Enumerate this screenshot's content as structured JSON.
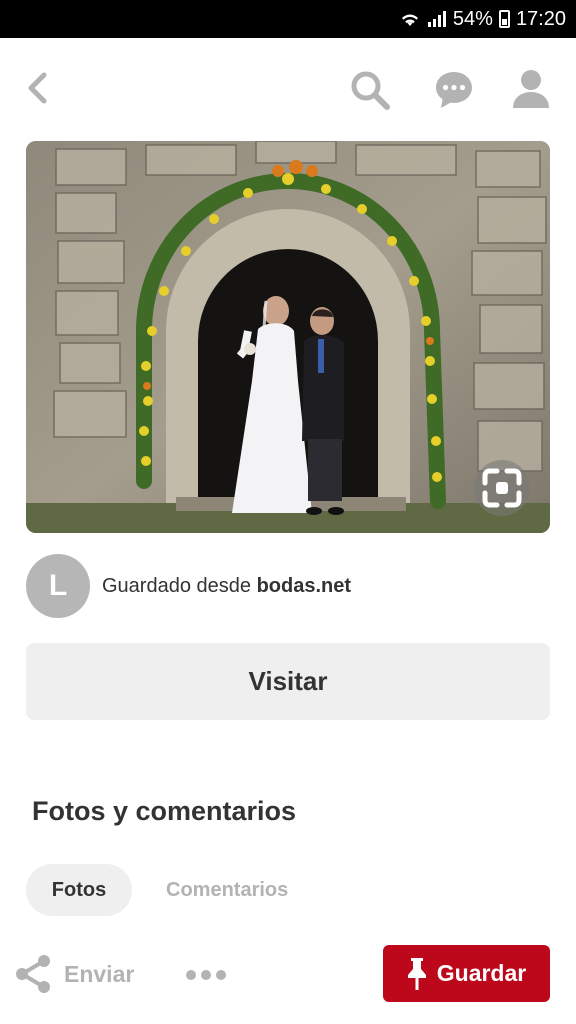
{
  "status_bar": {
    "battery": "54%",
    "time": "17:20"
  },
  "toolbar": {
    "icons": [
      "back-icon",
      "search-icon",
      "chat-icon",
      "user-icon"
    ]
  },
  "pin": {
    "image_icon": "visual-search-icon"
  },
  "source": {
    "avatar_letter": "L",
    "prefix": "Guardado desde",
    "domain": "bodas.net"
  },
  "actions": {
    "visit_label": "Visitar"
  },
  "section": {
    "title": "Fotos y comentarios",
    "tabs": [
      "Fotos",
      "Comentarios"
    ]
  },
  "bottom": {
    "share_label": "Enviar",
    "save_label": "Guardar"
  },
  "colors": {
    "brand_red": "#bd081c",
    "icon_gray": "#b3b3b3",
    "text_dark": "#333333",
    "button_gray": "#efefef"
  }
}
